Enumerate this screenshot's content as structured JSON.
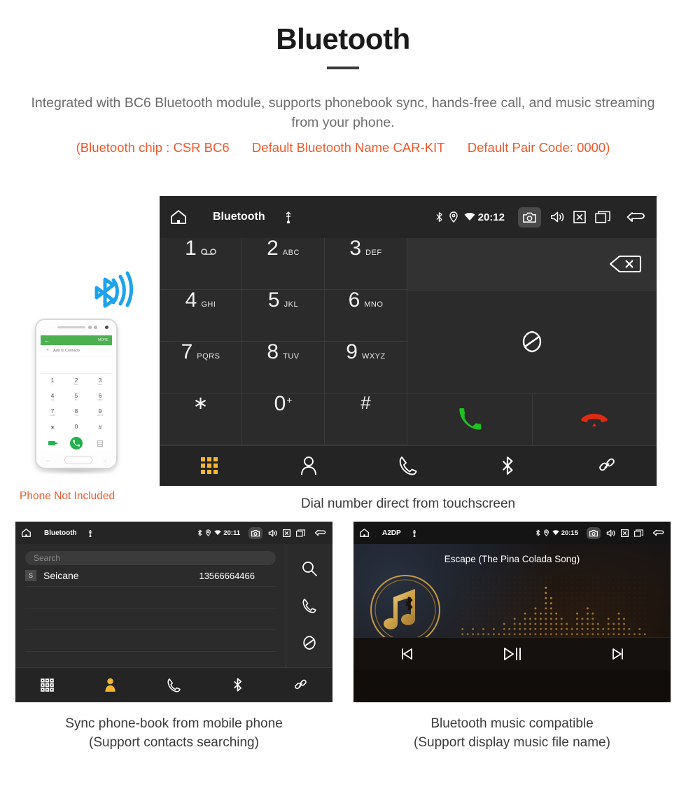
{
  "header": {
    "title": "Bluetooth",
    "description": "Integrated with BC6 Bluetooth module, supports phonebook sync, hands-free call, and music streaming from your phone.",
    "spec_chip": "(Bluetooth chip : CSR BC6",
    "spec_name": "Default Bluetooth Name CAR-KIT",
    "spec_pair": "Default Pair Code: 0000)",
    "accent_color": "#f0592b",
    "text_color": "#6d6d6d"
  },
  "phone_mockup": {
    "note": "Phone Not Included",
    "appbar_back": "←",
    "appbar_more": "MORE",
    "add_contacts": "Add to Contacts",
    "add_plus": "+",
    "keys": [
      {
        "n": "1",
        "s": "∞"
      },
      {
        "n": "2",
        "s": "ABC"
      },
      {
        "n": "3",
        "s": "DEF"
      },
      {
        "n": "4",
        "s": "GHI"
      },
      {
        "n": "5",
        "s": "JKL"
      },
      {
        "n": "6",
        "s": "MNO"
      },
      {
        "n": "7",
        "s": "PQRS"
      },
      {
        "n": "8",
        "s": "TUV"
      },
      {
        "n": "9",
        "s": "WXYZ"
      },
      {
        "n": "∗",
        "s": ""
      },
      {
        "n": "0",
        "s": "+"
      },
      {
        "n": "#",
        "s": ""
      }
    ],
    "bluetooth_icon": "bluetooth-signal-icon",
    "bluetooth_color": "#1ca3ec"
  },
  "dialer": {
    "caption": "Dial number direct from touchscreen",
    "statusbar": {
      "home_icon": "home-icon",
      "title": "Bluetooth",
      "usb_icon": "usb-icon",
      "bluetooth_icon": "bluetooth-icon",
      "location_icon": "location-icon",
      "wifi_icon": "wifi-icon",
      "time": "20:12",
      "camera_icon": "camera-icon",
      "volume_icon": "volume-icon",
      "close_icon": "close-box-icon",
      "recents_icon": "recents-icon",
      "back_icon": "back-icon"
    },
    "keys": [
      {
        "digit": "1",
        "letters": "",
        "voicemail": true
      },
      {
        "digit": "2",
        "letters": "ABC"
      },
      {
        "digit": "3",
        "letters": "DEF"
      },
      {
        "digit": "4",
        "letters": "GHI"
      },
      {
        "digit": "5",
        "letters": "JKL"
      },
      {
        "digit": "6",
        "letters": "MNO"
      },
      {
        "digit": "7",
        "letters": "PQRS"
      },
      {
        "digit": "8",
        "letters": "TUV"
      },
      {
        "digit": "9",
        "letters": "WXYZ"
      },
      {
        "digit": "∗",
        "letters": ""
      },
      {
        "digit": "0",
        "letters": "",
        "sup": "+"
      },
      {
        "digit": "#",
        "letters": ""
      }
    ],
    "input_value": "",
    "backspace_icon": "backspace-icon",
    "sync_icon": "sync-icon",
    "call_icon": "call-icon",
    "hangup_icon": "hangup-icon",
    "call_color": "#1fc11f",
    "hangup_color": "#e02b12",
    "tabs": [
      {
        "name": "keypad",
        "icon": "keypad-icon",
        "active": true
      },
      {
        "name": "contacts",
        "icon": "contact-icon",
        "active": false
      },
      {
        "name": "call-history",
        "icon": "phone-handset-icon",
        "active": false
      },
      {
        "name": "bluetooth",
        "icon": "bluetooth-icon",
        "active": false
      },
      {
        "name": "pair-link",
        "icon": "link-icon",
        "active": false
      }
    ],
    "active_tab_color": "#f5b731"
  },
  "phonebook": {
    "caption_line1": "Sync phone-book from mobile phone",
    "caption_line2": "(Support contacts searching)",
    "statusbar": {
      "home_icon": "home-icon",
      "title": "Bluetooth",
      "usb_icon": "usb-icon",
      "time": "20:11",
      "camera_icon": "camera-icon",
      "volume_icon": "volume-icon",
      "close_icon": "close-box-icon",
      "recents_icon": "recents-icon",
      "back_icon": "back-icon"
    },
    "search_placeholder": "Search",
    "search_value": "",
    "contacts": [
      {
        "badge": "S",
        "name": "Seicane",
        "number": "13566664466"
      }
    ],
    "empty_rows": 4,
    "side_actions": [
      {
        "name": "search",
        "icon": "search-icon"
      },
      {
        "name": "call",
        "icon": "phone-handset-icon"
      },
      {
        "name": "sync",
        "icon": "sync-icon"
      }
    ],
    "tabs": [
      {
        "name": "keypad",
        "icon": "keypad-icon",
        "active": false
      },
      {
        "name": "contacts",
        "icon": "contact-filled-icon",
        "active": true
      },
      {
        "name": "call-history",
        "icon": "phone-handset-icon",
        "active": false
      },
      {
        "name": "bluetooth",
        "icon": "bluetooth-icon",
        "active": false
      },
      {
        "name": "pair-link",
        "icon": "link-icon",
        "active": false
      }
    ],
    "active_tab_color": "#f5b731"
  },
  "music": {
    "caption_line1": "Bluetooth music compatible",
    "caption_line2": "(Support display music file name)",
    "statusbar": {
      "home_icon": "home-icon",
      "title": "A2DP",
      "usb_icon": "usb-icon",
      "time": "20:15",
      "camera_icon": "camera-icon",
      "volume_icon": "volume-icon",
      "close_icon": "close-box-icon",
      "recents_icon": "recents-icon",
      "back_icon": "back-icon"
    },
    "song_title": "Escape (The Pina Colada Song)",
    "album_art_icon": "music-note-bluetooth-icon",
    "equalizer_icon": "dot-matrix-equalizer",
    "accent_color": "#d1a14a",
    "controls": [
      {
        "name": "previous",
        "icon": "skip-previous-icon"
      },
      {
        "name": "play-pause",
        "icon": "play-pause-icon"
      },
      {
        "name": "next",
        "icon": "skip-next-icon"
      }
    ]
  }
}
